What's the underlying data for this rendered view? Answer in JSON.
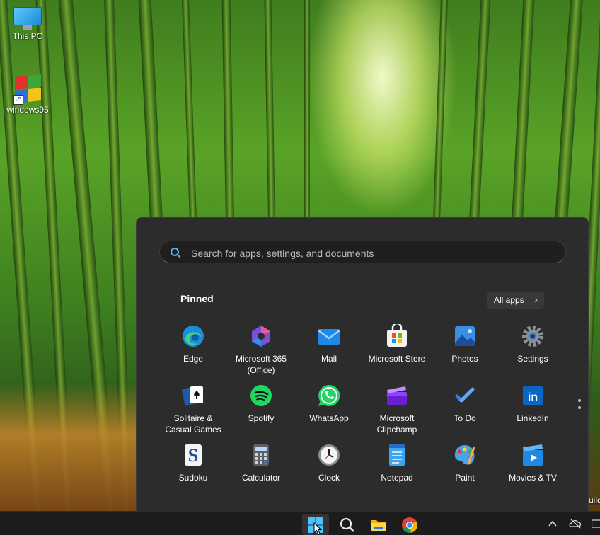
{
  "desktop": {
    "icons": [
      {
        "label": "This PC",
        "icon": "monitor-icon"
      },
      {
        "label": "windows95",
        "icon": "windows95-shortcut-icon"
      }
    ],
    "partial_text_right": "uild"
  },
  "start_menu": {
    "search": {
      "placeholder": "Search for apps, settings, and documents"
    },
    "pinned_title": "Pinned",
    "all_apps_label": "All apps",
    "apps": [
      {
        "label": "Edge",
        "icon": "edge-icon"
      },
      {
        "label": "Microsoft 365\n(Office)",
        "icon": "microsoft-365-icon"
      },
      {
        "label": "Mail",
        "icon": "mail-icon"
      },
      {
        "label": "Microsoft Store",
        "icon": "microsoft-store-icon"
      },
      {
        "label": "Photos",
        "icon": "photos-icon"
      },
      {
        "label": "Settings",
        "icon": "settings-gear-icon"
      },
      {
        "label": "Solitaire &\nCasual Games",
        "icon": "solitaire-icon"
      },
      {
        "label": "Spotify",
        "icon": "spotify-icon"
      },
      {
        "label": "WhatsApp",
        "icon": "whatsapp-icon"
      },
      {
        "label": "Microsoft\nClipchamp",
        "icon": "clipchamp-icon"
      },
      {
        "label": "To Do",
        "icon": "todo-check-icon"
      },
      {
        "label": "LinkedIn",
        "icon": "linkedin-icon"
      },
      {
        "label": "Sudoku",
        "icon": "sudoku-icon"
      },
      {
        "label": "Calculator",
        "icon": "calculator-icon"
      },
      {
        "label": "Clock",
        "icon": "clock-icon"
      },
      {
        "label": "Notepad",
        "icon": "notepad-icon"
      },
      {
        "label": "Paint",
        "icon": "paint-palette-icon"
      },
      {
        "label": "Movies & TV",
        "icon": "movies-tv-icon"
      }
    ]
  },
  "taskbar": {
    "items": [
      "start-button",
      "search-button",
      "file-explorer-button",
      "chrome-button"
    ],
    "tray": [
      "chevron-up-icon",
      "network-offline-icon",
      "keyboard-icon"
    ]
  }
}
